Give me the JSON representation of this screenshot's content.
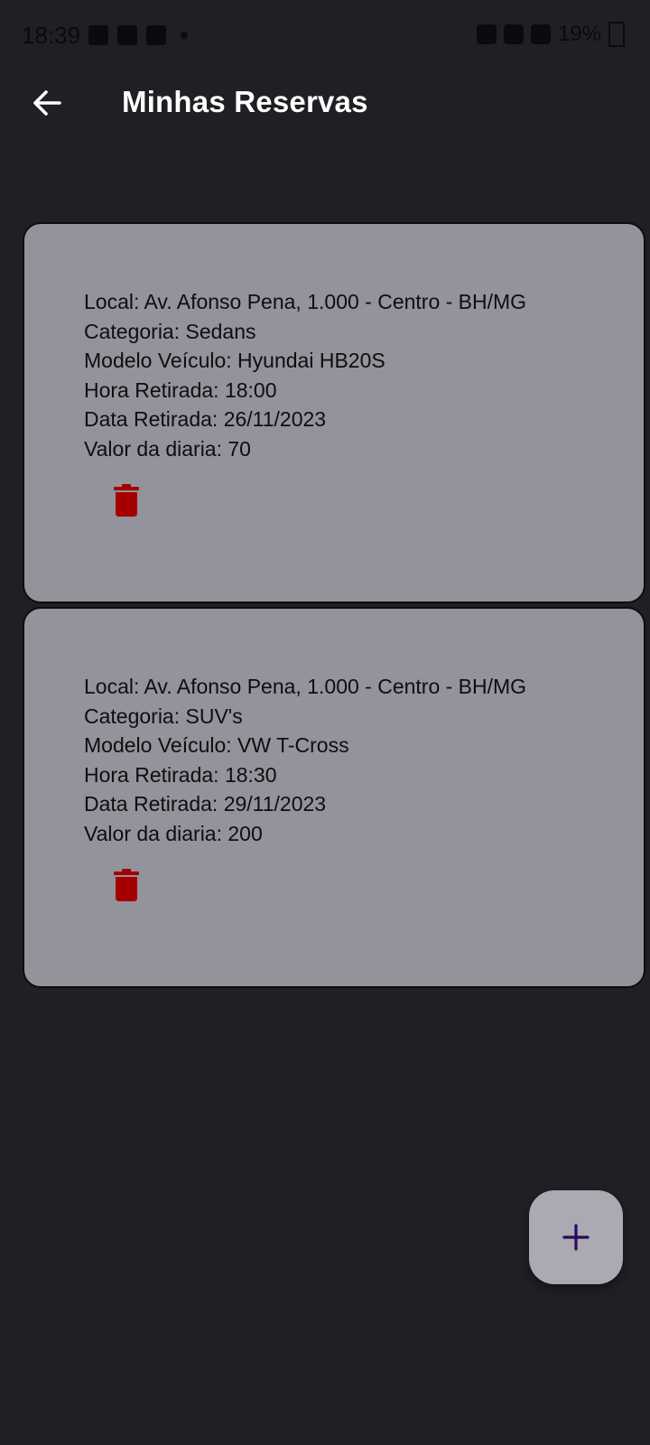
{
  "status_bar": {
    "time": "18:39",
    "battery": "19%"
  },
  "header": {
    "title": "Minhas Reservas",
    "back_icon": "arrow-left-icon"
  },
  "reservations": [
    {
      "local": "Local: Av. Afonso Pena, 1.000 - Centro - BH/MG",
      "categoria": "Categoria: Sedans",
      "modelo": "Modelo Veículo: Hyundai HB20S",
      "hora": "Hora Retirada: 18:00",
      "data": "Data Retirada: 26/11/2023",
      "valor": "Valor da diaria: 70",
      "delete_icon": "trash-icon"
    },
    {
      "local": "Local: Av. Afonso Pena, 1.000 - Centro - BH/MG",
      "categoria": "Categoria: SUV's",
      "modelo": "Modelo Veículo: VW T-Cross",
      "hora": "Hora Retirada: 18:30",
      "data": "Data Retirada: 29/11/2023",
      "valor": "Valor da diaria: 200",
      "delete_icon": "trash-icon"
    }
  ],
  "fab": {
    "icon": "plus-icon"
  },
  "colors": {
    "background": "#1f2024",
    "card": "#92939b",
    "delete": "#a50000",
    "fab": "#a9aab2",
    "fab_icon": "#2b0a5e"
  }
}
